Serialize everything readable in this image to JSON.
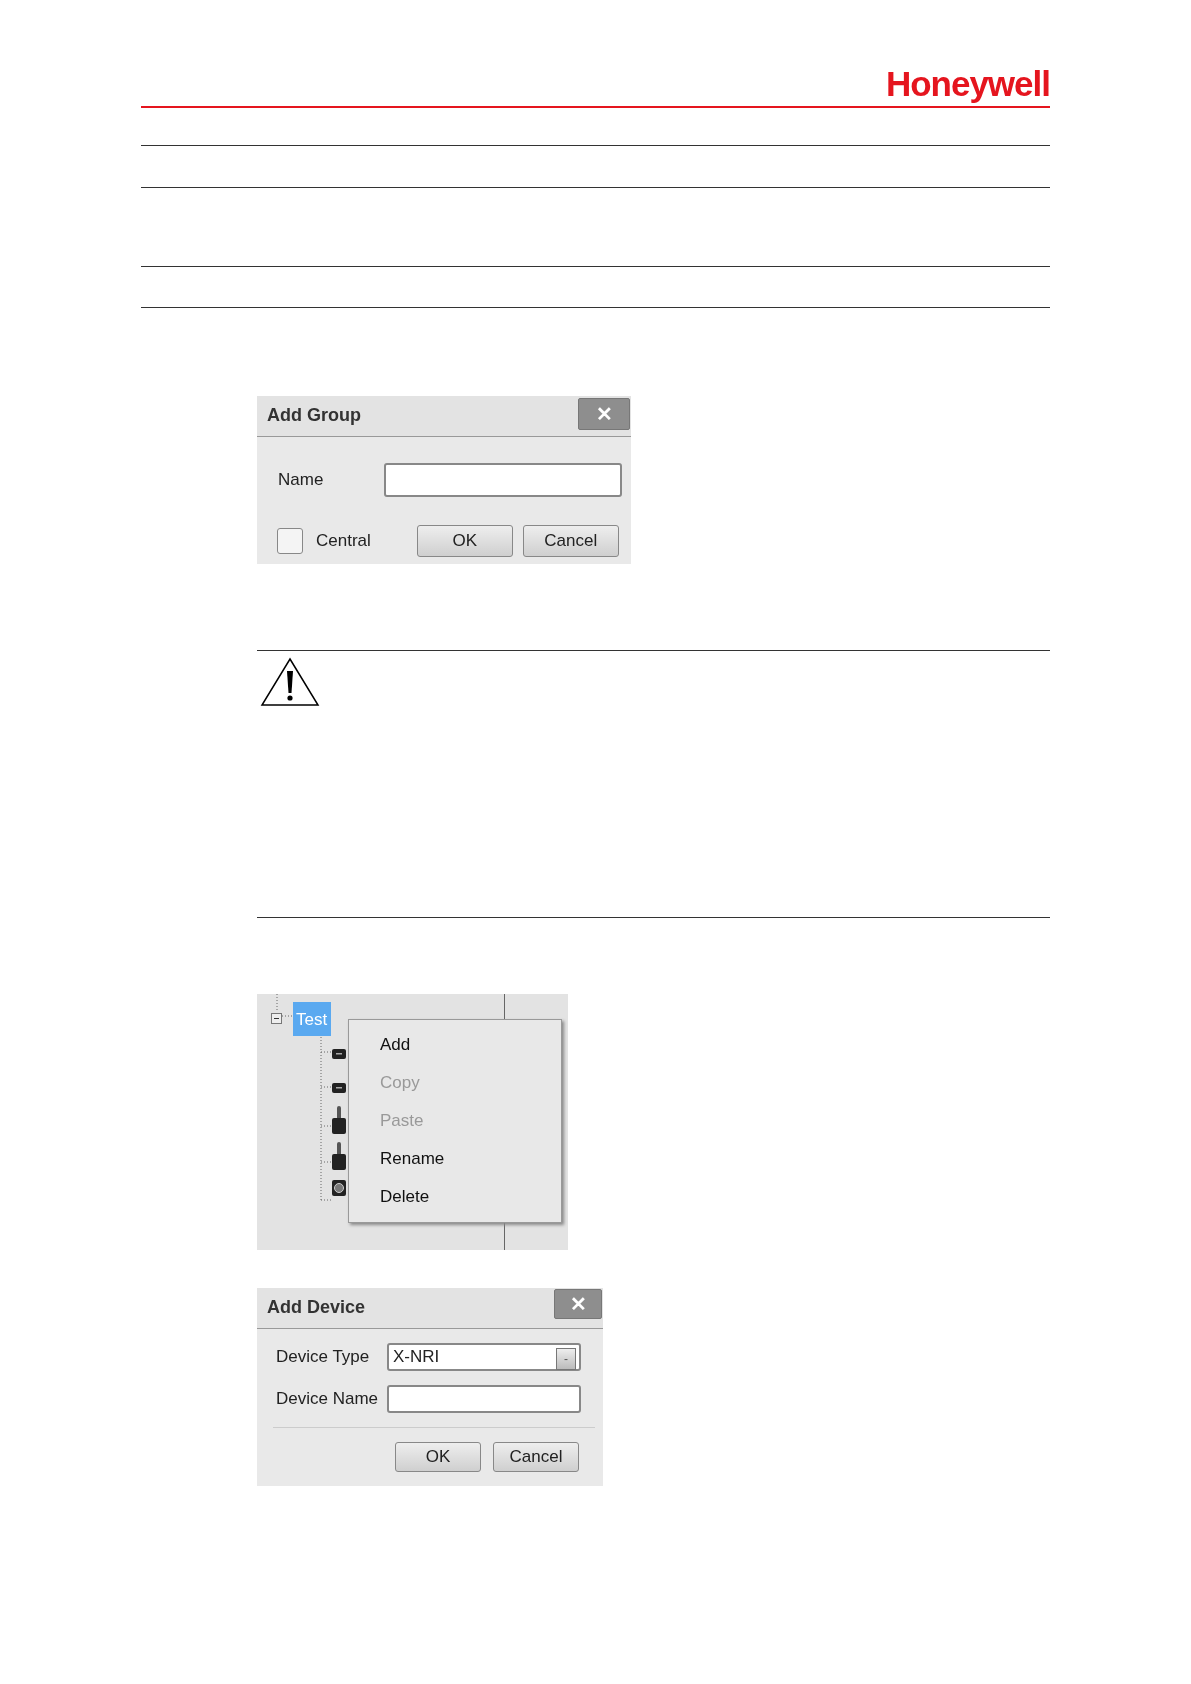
{
  "header": {
    "logo": "Honeywell"
  },
  "add_group_dialog": {
    "title": "Add Group",
    "close": "✕",
    "name_label": "Name",
    "central": {
      "label": "Central",
      "checked": false
    },
    "buttons": [
      "OK",
      "Cancel"
    ]
  },
  "warning": {
    "kind": "caution"
  },
  "tree": {
    "root": {
      "label": "Test",
      "selected": true,
      "expanded": true,
      "children": [
        {
          "kind": "recorder"
        },
        {
          "kind": "recorder"
        },
        {
          "kind": "keyboard"
        },
        {
          "kind": "keyboard"
        },
        {
          "kind": "camera"
        }
      ]
    },
    "context_menu": [
      {
        "label": "Add",
        "disabled": false
      },
      {
        "label": "Copy",
        "disabled": true
      },
      {
        "label": "Paste",
        "disabled": true
      },
      {
        "label": "Rename",
        "disabled": false
      },
      {
        "label": "Delete",
        "disabled": false
      }
    ]
  },
  "add_device_dialog": {
    "title": "Add Device",
    "close": "✕",
    "device_type_label": "Device Type",
    "device_type_value": "X-NRI",
    "dropdown_glyph": "-",
    "device_name_label": "Device Name",
    "buttons": [
      "OK",
      "Cancel"
    ]
  }
}
